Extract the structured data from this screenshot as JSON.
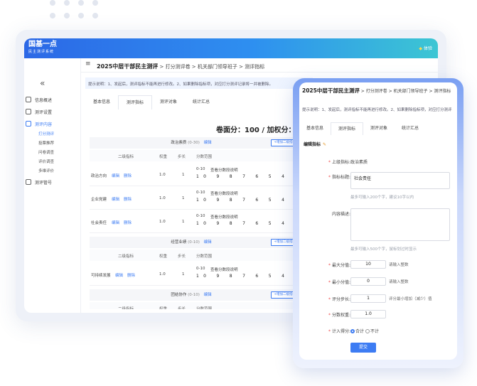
{
  "brand": {
    "name": "国基一点",
    "subtitle": "民主测评系统"
  },
  "header": {
    "experience": "体验"
  },
  "sidebar": {
    "items": [
      {
        "label": "信息概述"
      },
      {
        "label": "测评设置"
      },
      {
        "label": "测评内容"
      },
      {
        "label": "测评管号"
      }
    ],
    "subitems": [
      {
        "label": "打分测评"
      },
      {
        "label": "投票推荐"
      },
      {
        "label": "问卷调查"
      },
      {
        "label": "评价调查"
      },
      {
        "label": "多维评价"
      }
    ]
  },
  "breadcrumb": {
    "title": "2025中层干部民主测评",
    "rest": " > 打分测评卷 > 机关部门领导班子 > 测评指标"
  },
  "notice": "提示说明：1、发起后，测评指标不能再进行修改。2、如果删除指标项，对应打分测评记录将一并被删除。",
  "tabs": [
    "基本信息",
    "测评指标",
    "测评对象",
    "统计汇总"
  ],
  "score_summary": "卷面分：100 / 加权分：10",
  "groups": [
    {
      "name": "政治素质",
      "range": "(0-30)",
      "edit": "编辑",
      "add": "+增加二级指标"
    },
    {
      "name": "经营业绩",
      "range": "(0-10)",
      "edit": "编辑",
      "add": "+增加二级指标"
    },
    {
      "name": "团结协作",
      "range": "(0-10)",
      "edit": "编辑",
      "add": "+增加二级指标"
    }
  ],
  "columns": {
    "secondary": "二级指标",
    "weight": "权重",
    "step": "步长",
    "range": "分数范围"
  },
  "rows": [
    {
      "name": "政治方向",
      "edit": "编辑",
      "del": "删除",
      "weight": "1.0",
      "step": "1",
      "range": "0-10",
      "view": "查看分数段说明",
      "scale": "10 9 8 7 6 5 4 3 2"
    },
    {
      "name": "企业党建",
      "edit": "编辑",
      "del": "删除",
      "weight": "1.0",
      "step": "1",
      "range": "0-10",
      "view": "查看分数段说明",
      "scale": "10 9 8 7 6 5 4 3 2"
    },
    {
      "name": "社会责任",
      "edit": "编辑",
      "del": "删除",
      "weight": "1.0",
      "step": "1",
      "range": "0-10",
      "view": "查看分数段说明",
      "scale": "10 9 8 7 6 5 4 3 2"
    },
    {
      "name": "可持续发展",
      "edit": "编辑",
      "del": "删除",
      "weight": "1.0",
      "step": "1",
      "range": "0-10",
      "view": "查看分数段说明",
      "scale": "10 9 8 7 6 5 4 3 2"
    }
  ],
  "front": {
    "breadcrumb_title": "2025中层干部民主测评",
    "breadcrumb_rest": " > 打分测评卷 > 机关部门领导班子 > 测评指标",
    "notice": "提示说明：1、发起后，测评指标不能再进行修改。2、如果删除指标项，对应打分测评",
    "section": "编辑指标",
    "parent_label": "上级指标:",
    "parent_value": "政治素质",
    "title_label": "指标标题:",
    "title_value": "社会责任",
    "title_hint": "最多可输入200个字，建议10字以内",
    "desc_label": "内容描述:",
    "desc_hint": "最多可输入500个字，鼠标划过时显示",
    "max_label": "最大分值:",
    "max_value": "10",
    "max_unit": "请输入整数",
    "min_label": "最小分值:",
    "min_value": "0",
    "min_unit": "请输入整数",
    "step_label": "评分步长:",
    "step_value": "1",
    "step_unit": "评分最小增加（减少）值",
    "weight_label": "分数权重:",
    "weight_value": "1.0",
    "count_label": "计入得分:",
    "opt_yes": "合计",
    "opt_no": "不计",
    "submit": "提交"
  }
}
